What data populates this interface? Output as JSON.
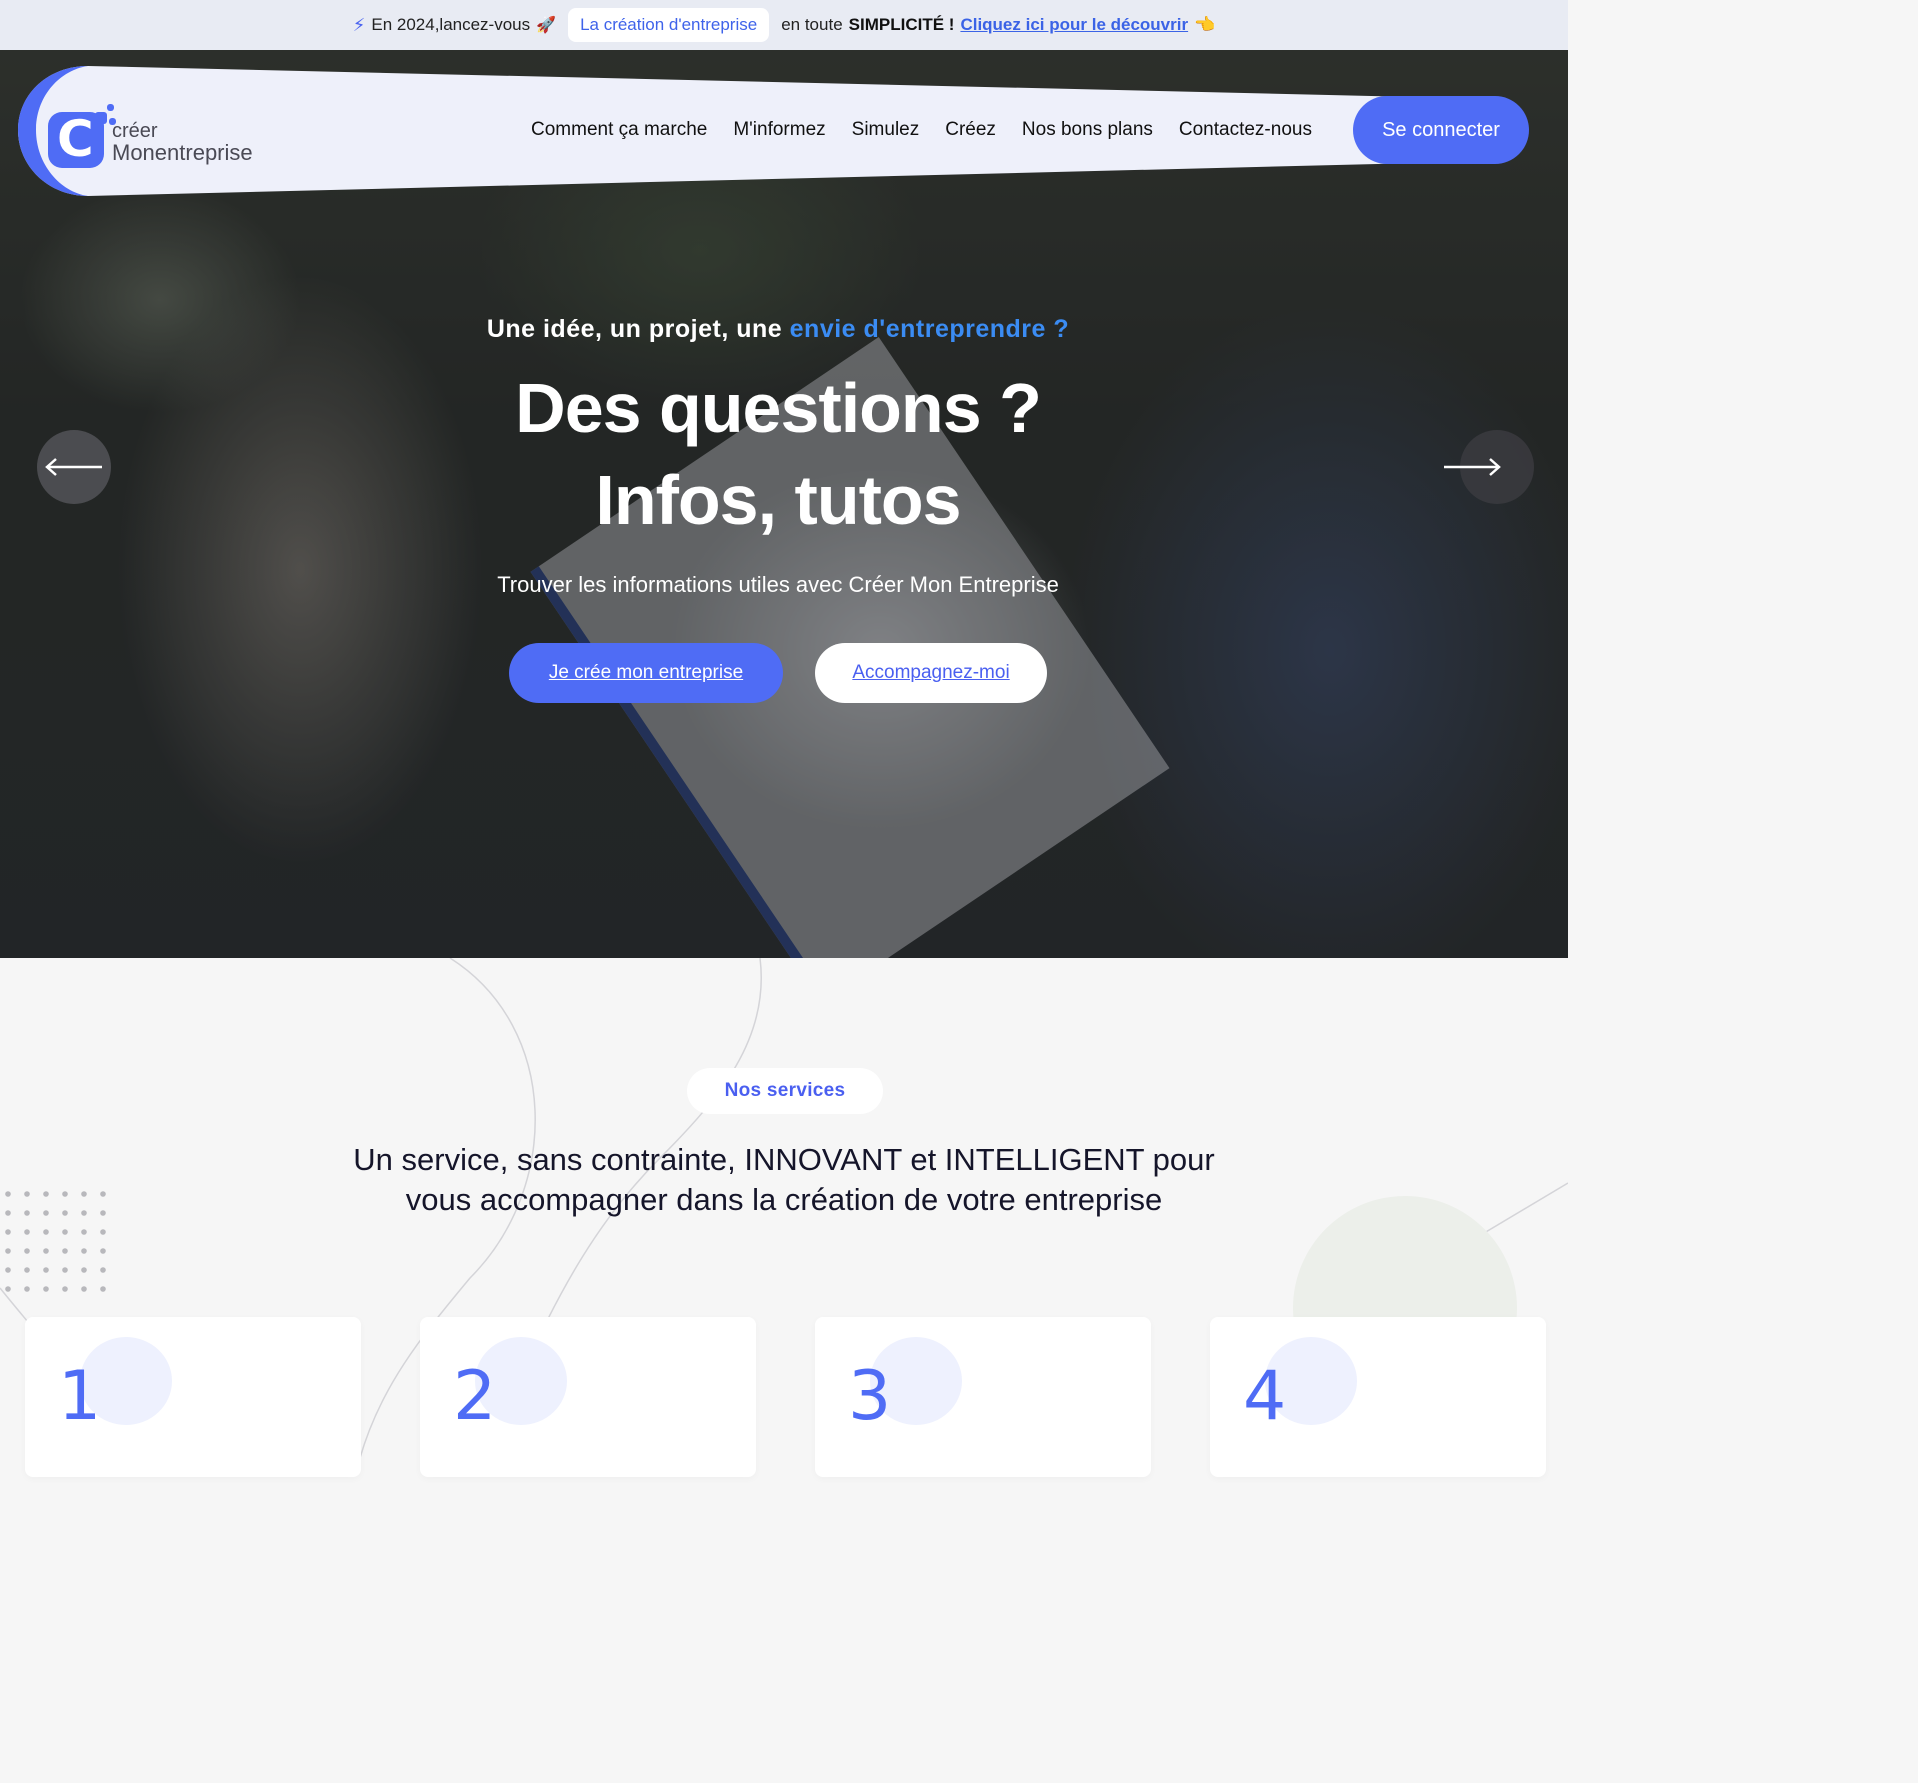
{
  "announcement": {
    "prefix": "En 2024,lancez-vous",
    "pill": "La création d'entreprise",
    "middle": "en toute",
    "emphasis": "SIMPLICITÉ !",
    "link": "Cliquez ici pour le découvrir",
    "link_emoji": "👈"
  },
  "brand": {
    "line1": "créer",
    "line2": "Monentreprise",
    "color": "#4f6cf5"
  },
  "nav": {
    "items": [
      {
        "label": "Comment ça marche"
      },
      {
        "label": "M'informez"
      },
      {
        "label": "Simulez"
      },
      {
        "label": "Créez"
      },
      {
        "label": "Nos bons plans"
      },
      {
        "label": "Contactez-nous"
      }
    ],
    "login": "Se connecter"
  },
  "hero": {
    "kicker": "Une idée, un projet, une",
    "kicker_highlight": "envie d'entreprendre ?",
    "title_line1": "Des questions ?",
    "title_line2": "Infos, tutos",
    "subtitle": "Trouver les informations utiles avec Créer Mon Entreprise",
    "cta_primary": "Je crée mon entreprise",
    "cta_secondary": "Accompagnez-moi"
  },
  "services": {
    "badge": "Nos services",
    "title": "Un service, sans contrainte, INNOVANT et INTELLIGENT pour vous accompagner dans la création de votre entreprise",
    "cards": [
      {
        "number": "1"
      },
      {
        "number": "2"
      },
      {
        "number": "3"
      },
      {
        "number": "4"
      }
    ]
  }
}
